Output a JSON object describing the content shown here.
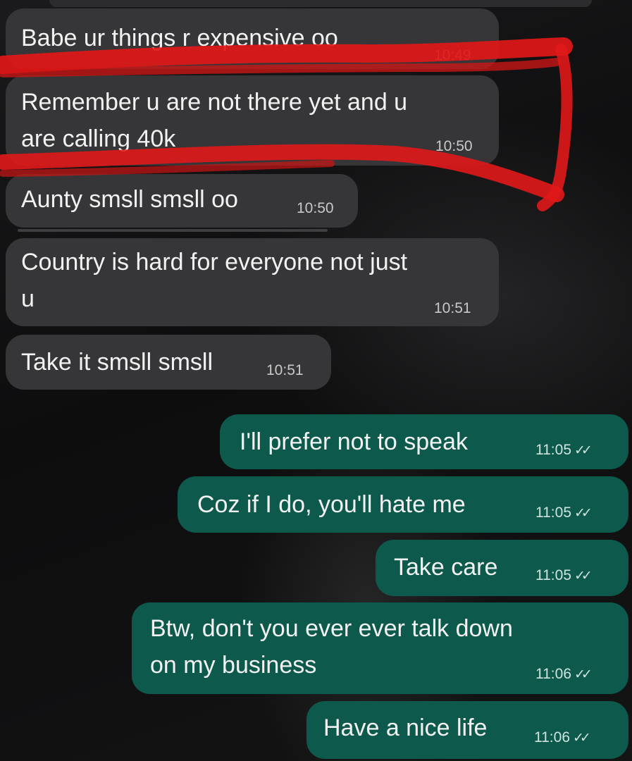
{
  "chat": {
    "messages": [
      {
        "direction": "incoming",
        "text": "Babe ur things r expensive oo",
        "time": "10:49"
      },
      {
        "direction": "incoming",
        "text": "Remember u are not there yet and u\nare calling 40k",
        "time": "10:50",
        "highlighted": true
      },
      {
        "direction": "incoming",
        "text": "Aunty smsll smsll oo",
        "time": "10:50"
      },
      {
        "direction": "incoming",
        "text": "Country is hard for everyone not just\nu",
        "time": "10:51"
      },
      {
        "direction": "incoming",
        "text": "Take it smsll smsll",
        "time": "10:51"
      },
      {
        "direction": "outgoing",
        "text": "I'll prefer not to speak",
        "time": "11:05",
        "status": "read"
      },
      {
        "direction": "outgoing",
        "text": "Coz if I do, you'll hate me",
        "time": "11:05",
        "status": "read"
      },
      {
        "direction": "outgoing",
        "text": "Take care",
        "time": "11:05",
        "status": "read"
      },
      {
        "direction": "outgoing",
        "text": "Btw, don't you ever ever talk down\non my business",
        "time": "11:06",
        "status": "read"
      },
      {
        "direction": "outgoing",
        "text": "Have a nice life",
        "time": "11:06",
        "status": "read"
      }
    ]
  },
  "icons": {
    "read_receipt": "double-check-icon"
  },
  "colors": {
    "incoming_bubble": "#363638",
    "outgoing_bubble": "#0d5a4d",
    "highlight_annotation": "#e01818",
    "background": "#0b0b0c"
  }
}
